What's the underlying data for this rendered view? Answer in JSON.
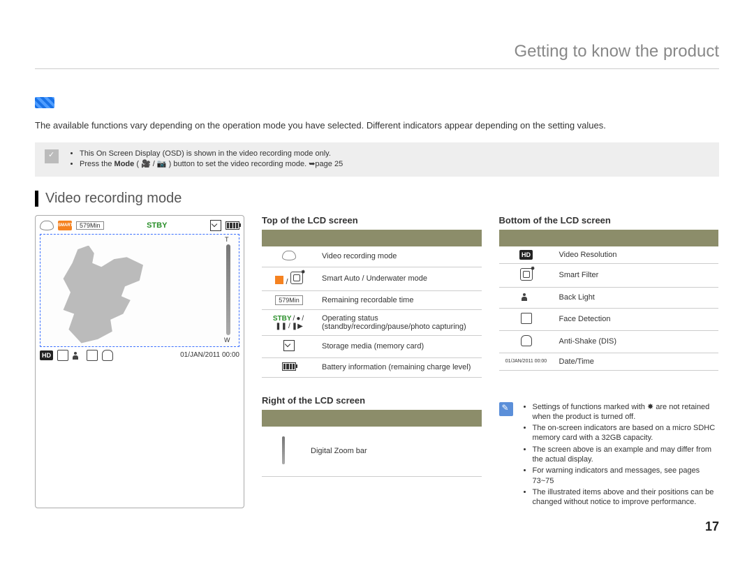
{
  "chapter_title": "Getting to know the product",
  "intro": "The available functions vary depending on the operation mode you have selected. Different indicators appear depending on the setting values.",
  "note_box": {
    "items": [
      "This On Screen Display (OSD) is shown in the video recording mode only.",
      "Press the Mode ( 🎥 / 📷 ) button to set the video recording mode. ➥page 25"
    ]
  },
  "section_title": "Video recording mode",
  "lcd": {
    "smart_label": "SMART",
    "remaining": "579Min",
    "stby": "STBY",
    "datetime": "01/JAN/2011 00:00"
  },
  "top_table": {
    "title": "Top of the LCD screen",
    "rows": [
      {
        "label": "",
        "desc": "Video recording mode"
      },
      {
        "label": "",
        "desc": "Smart Auto / Underwater mode"
      },
      {
        "label": "579Min",
        "desc": "Remaining recordable time"
      },
      {
        "label": "",
        "desc": "Operating status (standby/recording/pause/photo capturing)"
      },
      {
        "label": "",
        "desc": "Storage media (memory card)"
      },
      {
        "label": "",
        "desc": "Battery information (remaining charge level)"
      }
    ]
  },
  "bottom_table": {
    "title": "Bottom of the LCD screen",
    "rows": [
      {
        "label": "",
        "desc": "Video Resolution"
      },
      {
        "label": "",
        "desc": "Smart Filter"
      },
      {
        "label": "",
        "desc": "Back Light"
      },
      {
        "label": "",
        "desc": "Face Detection"
      },
      {
        "label": "",
        "desc": "Anti-Shake (DIS)"
      },
      {
        "label": "01/JAN/2011 00:00",
        "desc": "Date/Time"
      }
    ]
  },
  "right_table": {
    "title": "Right of the LCD screen",
    "rows": [
      {
        "label": "",
        "desc": "Digital Zoom bar"
      }
    ]
  },
  "note2": {
    "items": [
      "Settings of functions marked with ✸ are not retained when the product is turned off.",
      "The on-screen indicators are based on a micro SDHC memory card with a 32GB capacity.",
      "The screen above is an example and may differ from the actual display.",
      "For warning indicators and messages, see pages 73~75",
      "The illustrated items above and their positions can be changed without notice to improve performance."
    ]
  },
  "page_number": "17",
  "status_labels": {
    "stby": "STBY",
    "rec": "●",
    "pause": "❚❚",
    "shot": "❚▶"
  }
}
